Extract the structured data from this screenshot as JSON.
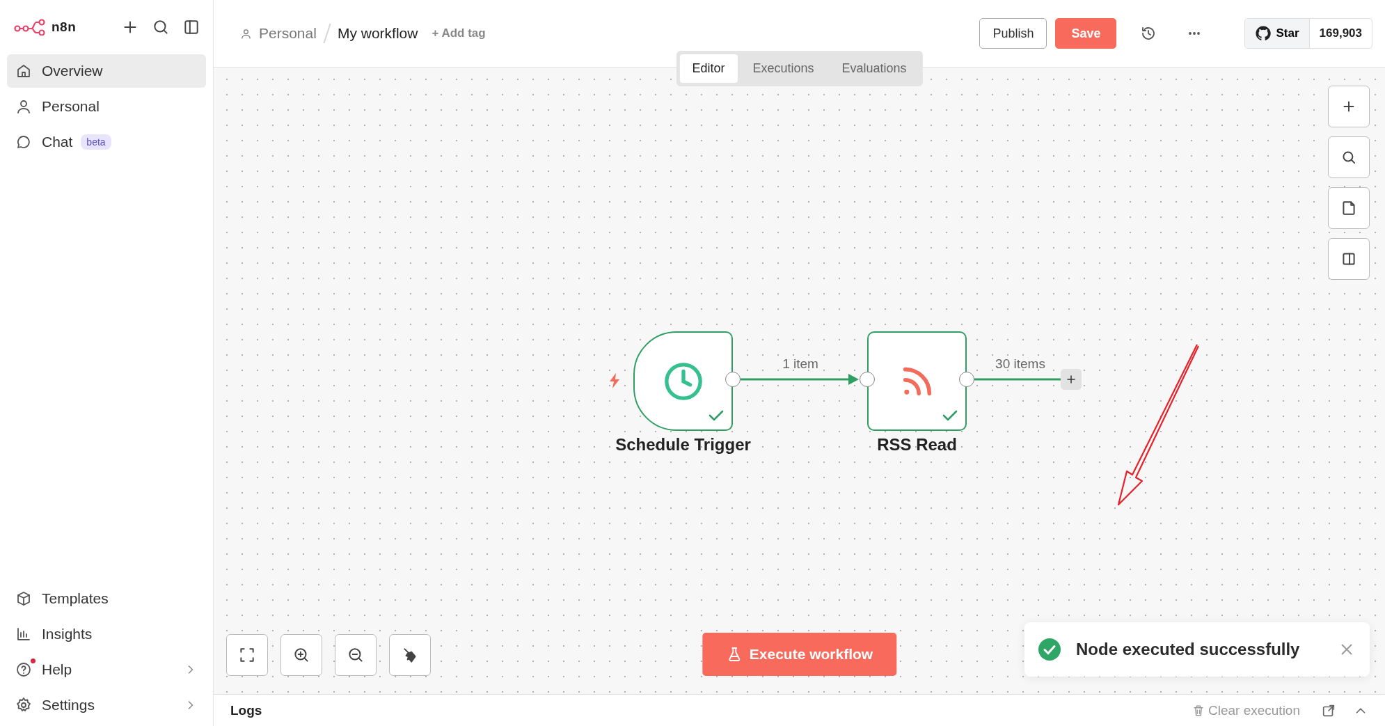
{
  "sidebar": {
    "logo": "n8n",
    "items": [
      {
        "label": "Overview",
        "selected": true
      },
      {
        "label": "Personal",
        "selected": false
      },
      {
        "label": "Chat",
        "selected": false,
        "badge": "beta"
      }
    ],
    "bottom_items": [
      {
        "label": "Templates",
        "notification": false,
        "chevron": false
      },
      {
        "label": "Insights",
        "notification": false,
        "chevron": false
      },
      {
        "label": "Help",
        "notification": true,
        "chevron": true
      },
      {
        "label": "Settings",
        "notification": false,
        "chevron": true
      }
    ]
  },
  "header": {
    "breadcrumb": [
      "Personal",
      "My workflow"
    ],
    "add_tag": "+ Add tag",
    "publish": "Publish",
    "save": "Save",
    "github": {
      "label": "Star",
      "count": "169,903"
    }
  },
  "tabs": [
    {
      "label": "Editor",
      "selected": true
    },
    {
      "label": "Executions",
      "selected": false
    },
    {
      "label": "Evaluations",
      "selected": false
    }
  ],
  "canvas": {
    "nodes": [
      {
        "kind": "trigger",
        "label": "Schedule Trigger",
        "success": true
      },
      {
        "kind": "rss",
        "label": "RSS Read",
        "success": true
      }
    ],
    "connections": [
      {
        "label": "1 item"
      },
      {
        "label": "30 items"
      }
    ]
  },
  "execute_button": "Execute workflow",
  "toast": {
    "message": "Node executed successfully"
  },
  "logs": {
    "title": "Logs",
    "clear": "Clear execution"
  }
}
